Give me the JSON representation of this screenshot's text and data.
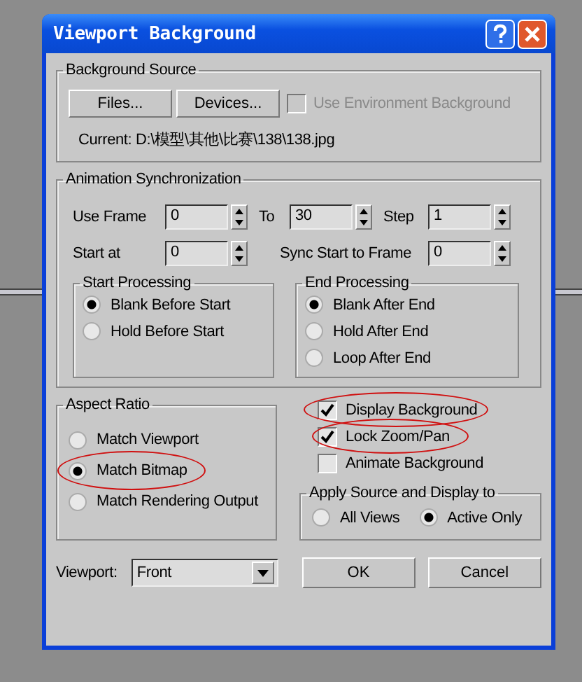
{
  "window": {
    "title": "Viewport Background"
  },
  "background_source": {
    "title": "Background Source",
    "buttons": [
      "Files...",
      "Devices..."
    ],
    "use_environment": {
      "label": "Use Environment Background",
      "checked": false,
      "disabled": true
    },
    "current": "Current:  D:\\模型\\其他\\比赛\\138\\138.jpg"
  },
  "animation": {
    "title": "Animation Synchronization",
    "fields": [
      {
        "label": "Use Frame",
        "value": "0"
      },
      {
        "label": "To",
        "value": "30"
      },
      {
        "label": "Step",
        "value": "1"
      },
      {
        "label": "Start at",
        "value": "0"
      },
      {
        "label": "Sync Start to Frame",
        "value": "0"
      }
    ],
    "start_processing": {
      "title": "Start Processing",
      "options": [
        {
          "label": "Blank Before Start",
          "selected": true
        },
        {
          "label": "Hold Before Start",
          "selected": false
        }
      ]
    },
    "end_processing": {
      "title": "End Processing",
      "options": [
        {
          "label": "Blank After End",
          "selected": true
        },
        {
          "label": "Hold After End",
          "selected": false
        },
        {
          "label": "Loop After End",
          "selected": false
        }
      ]
    }
  },
  "aspect_ratio": {
    "title": "Aspect Ratio",
    "options": [
      {
        "label": "Match Viewport",
        "selected": false,
        "circled": false
      },
      {
        "label": "Match Bitmap",
        "selected": true,
        "circled": true
      },
      {
        "label": "Match Rendering Output",
        "selected": false,
        "circled": false
      }
    ]
  },
  "display_options": [
    {
      "label": "Display Background",
      "checked": true,
      "circled": true
    },
    {
      "label": "Lock Zoom/Pan",
      "checked": true,
      "circled": true
    },
    {
      "label": "Animate Background",
      "checked": false,
      "circled": false
    }
  ],
  "apply_to": {
    "title": "Apply Source and Display to",
    "options": [
      {
        "label": "All Views",
        "selected": false
      },
      {
        "label": "Active Only",
        "selected": true
      }
    ]
  },
  "viewport": {
    "label": "Viewport:",
    "value": "Front"
  },
  "buttons": [
    "OK",
    "Cancel"
  ]
}
